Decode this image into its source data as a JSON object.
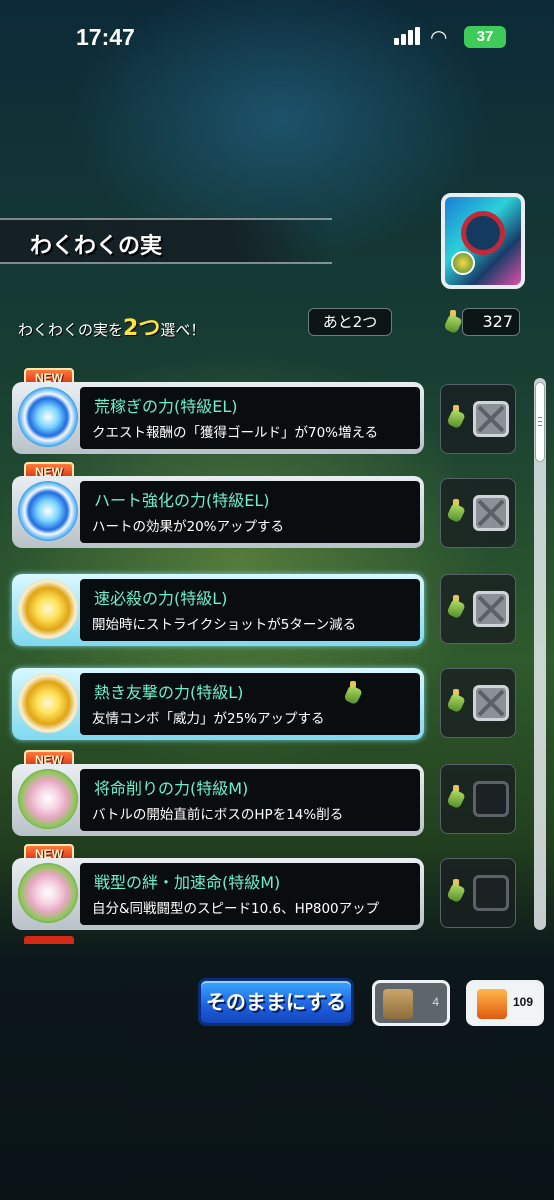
{
  "status": {
    "time": "17:47",
    "battery": "37"
  },
  "title": "わくわくの実",
  "instruction": {
    "prefix": "わくわくの実を",
    "highlight": "2つ",
    "suffix": "選べ！"
  },
  "remaining": "あと2つ",
  "currency_count": "327",
  "new_badge": "NEW",
  "items": [
    {
      "name": "荒稼ぎの力(特級EL)",
      "desc": "クエスト報酬の「獲得ゴールド」が70%増える",
      "icon": "blue-flower-icon",
      "new": true,
      "selected": false,
      "checkbox": "disabled"
    },
    {
      "name": "ハート強化の力(特級EL)",
      "desc": "ハートの効果が20%アップする",
      "icon": "blue-flower-icon",
      "new": true,
      "selected": false,
      "checkbox": "disabled"
    },
    {
      "name": "速必殺の力(特級L)",
      "desc": "開始時にストライクショットが5ターン減る",
      "icon": "gold-burst-icon",
      "new": false,
      "selected": true,
      "checkbox": "disabled"
    },
    {
      "name": "熱き友撃の力(特級L)",
      "desc": "友情コンボ「威力」が25%アップする",
      "icon": "gold-burst-icon",
      "new": false,
      "selected": true,
      "checkbox": "disabled"
    },
    {
      "name": "将命削りの力(特級M)",
      "desc": "バトルの開始直前にボスのHPを14%削る",
      "icon": "lotus-icon",
      "new": true,
      "selected": false,
      "checkbox": "empty"
    },
    {
      "name": "戦型の絆・加速命(特級M)",
      "desc": "自分&同戦闘型のスピード10.6、HP800アップ",
      "icon": "lotus-icon",
      "new": true,
      "selected": false,
      "checkbox": "empty"
    }
  ],
  "buttons": {
    "keep": "そのままにする",
    "item1_count": "4",
    "item2_count": "109"
  }
}
